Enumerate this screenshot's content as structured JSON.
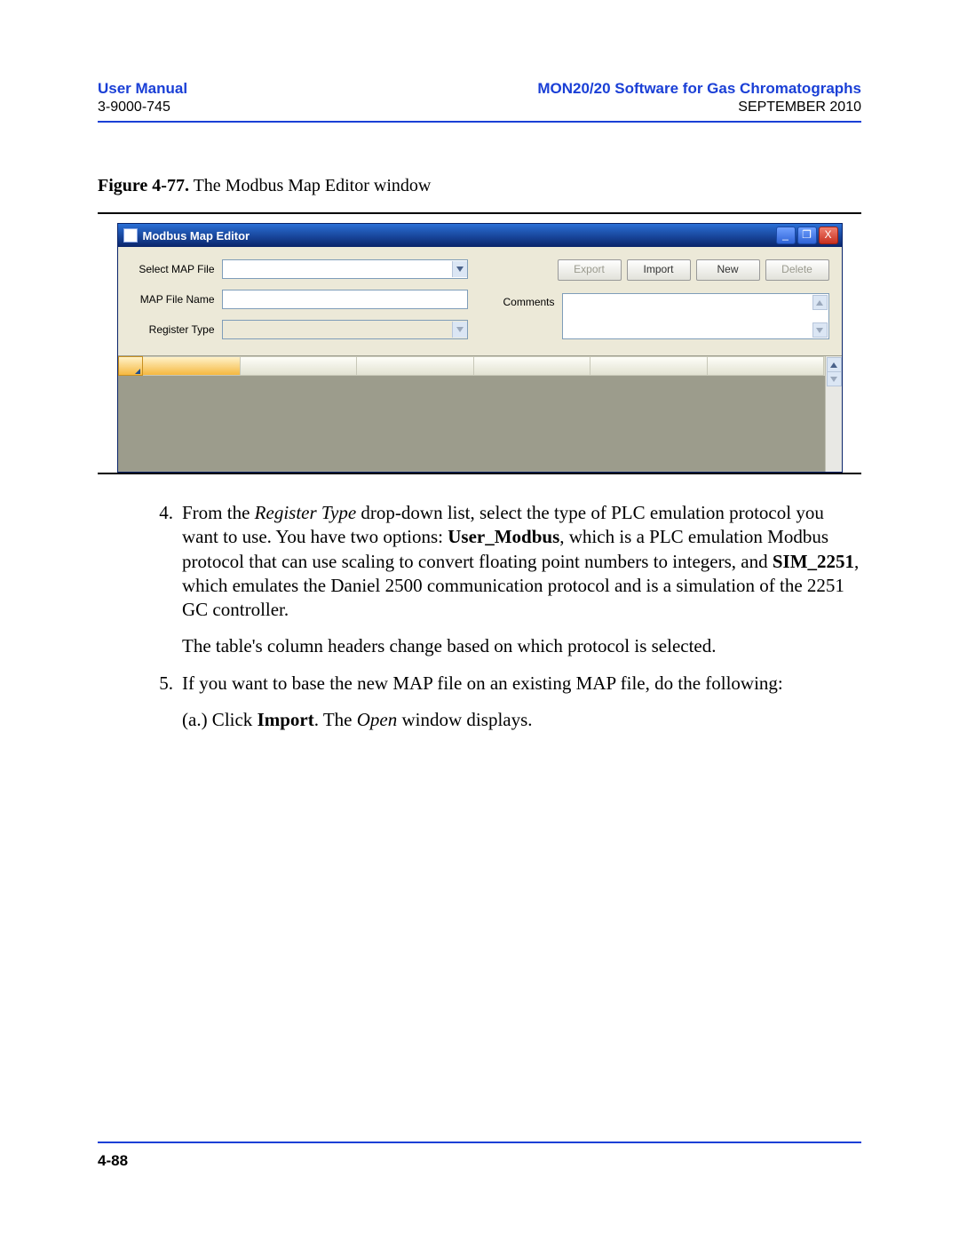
{
  "header": {
    "left_title": "User Manual",
    "left_sub": "3-9000-745",
    "right_title": "MON20/20 Software for Gas Chromatographs",
    "right_sub": "SEPTEMBER 2010"
  },
  "figure": {
    "label": "Figure 4-77.",
    "caption": "  The Modbus Map Editor window"
  },
  "window": {
    "title": "Modbus Map Editor",
    "controls": {
      "minimize": "_",
      "maximize": "❐",
      "close": "X"
    },
    "labels": {
      "select_map": "Select MAP File",
      "map_name": "MAP File Name",
      "register_type": "Register Type",
      "comments": "Comments"
    },
    "buttons": {
      "export": "Export",
      "import": "Import",
      "new": "New",
      "delete": "Delete"
    },
    "values": {
      "select_map": "",
      "map_name": "",
      "register_type": "",
      "comments": ""
    }
  },
  "body": {
    "item4_num": "4.",
    "item4_p1a": "From the ",
    "item4_p1b": "Register Type",
    "item4_p1c": " drop-down list, select the type of PLC emulation protocol you want to use.  You have two options: ",
    "item4_p1d": "User_Modbus",
    "item4_p1e": ", which is a PLC emulation Modbus protocol that can use scaling to convert floating point numbers to integers, and ",
    "item4_p1f": "SIM_2251",
    "item4_p1g": ", which emulates the Daniel 2500 communication protocol and is a simulation of the 2251 GC controller.",
    "item4_p2": "The table's column headers change based on which protocol is selected.",
    "item5_num": "5.",
    "item5_p1": "If you want to base the new MAP file on an existing MAP file, do the following:",
    "item5_a_a": "(a.) Click ",
    "item5_a_b": "Import",
    "item5_a_c": ".  The ",
    "item5_a_d": "Open",
    "item5_a_e": " window displays."
  },
  "footer": {
    "page": "4-88"
  }
}
